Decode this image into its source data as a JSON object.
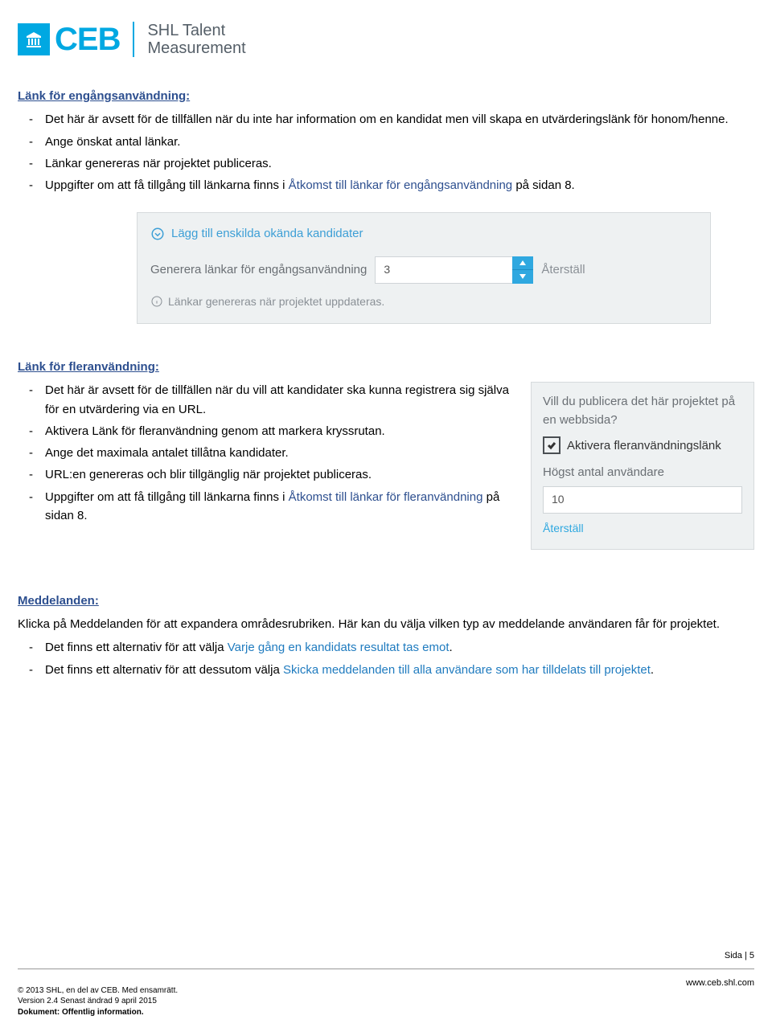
{
  "logo": {
    "ceb": "CEB",
    "shl1": "SHL Talent",
    "shl2": "Measurement"
  },
  "sec1": {
    "title": "Länk för engångsanvändning:",
    "b1": "Det här är avsett för de tillfällen när du inte har information om en kandidat men vill skapa en utvärderingslänk för honom/henne.",
    "b2": "Ange önskat antal länkar.",
    "b3": "Länkar genereras när projektet publiceras.",
    "b4a": "Uppgifter om att få tillgång till länkarna finns i ",
    "b4b": "Åtkomst till länkar för engångsanvändning",
    "b4c": " på sidan 8."
  },
  "panel1": {
    "hdr": "Lägg till enskilda okända kandidater",
    "gen": "Generera länkar för engångsanvändning",
    "val": "3",
    "reset": "Återställ",
    "info": "Länkar genereras när projektet uppdateras."
  },
  "sec2": {
    "title": "Länk för fleranvändning:",
    "b1": "Det här är avsett för de tillfällen när du vill att kandidater ska kunna registrera sig själva för en utvärdering via en URL.",
    "b2": "Aktivera Länk för fleranvändning genom att markera kryssrutan.",
    "b3": "Ange det maximala antalet tillåtna kandidater.",
    "b4": "URL:en genereras och blir tillgänglig när projektet publiceras.",
    "b5a": "Uppgifter om att få tillgång till länkarna finns i ",
    "b5b": "Åtkomst till länkar för fleranvändning",
    "b5c": " på sidan 8."
  },
  "panel2": {
    "q": "Vill du publicera det här projektet på en webbsida?",
    "chk": "Aktivera fleranvändningslänk",
    "lbl": "Högst antal användare",
    "val": "10",
    "reset": "Återställ"
  },
  "sec3": {
    "title": "Meddelanden:",
    "p1": "Klicka på Meddelanden för att expandera områdesrubriken. Här kan du välja vilken typ av meddelande användaren får för projektet.",
    "b1a": "Det finns ett alternativ för att välja ",
    "b1b": "Varje gång en kandidats resultat tas emot",
    "b1c": ".",
    "b2a": "Det finns ett alternativ för att dessutom välja ",
    "b2b": "Skicka meddelanden till alla användare som har tilldelats till projektet",
    "b2c": "."
  },
  "footer": {
    "page": "Sida | 5",
    "c1": "© 2013 SHL, en del av CEB. Med ensamrätt.",
    "c2": "Version 2.4  Senast ändrad 9 april 2015",
    "c3": "Dokument: Offentlig information.",
    "url": "www.ceb.shl.com"
  }
}
